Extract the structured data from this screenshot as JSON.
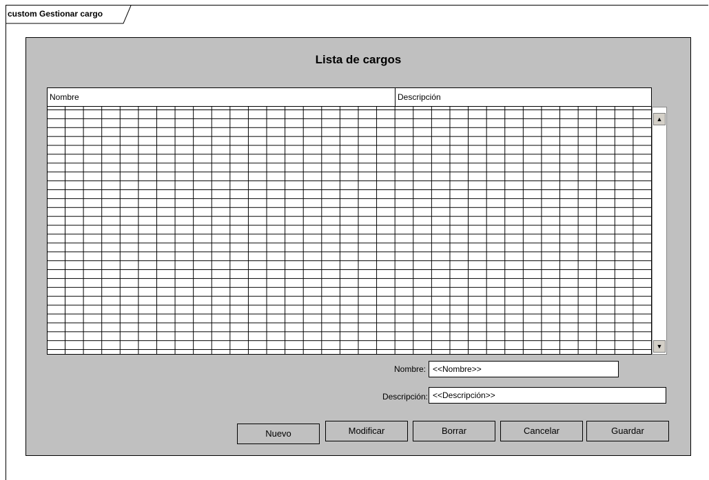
{
  "frame": {
    "title": "custom Gestionar cargo"
  },
  "window": {
    "title": "Lista de cargos",
    "table": {
      "columns": [
        "Nombre",
        "Descripción"
      ]
    },
    "form": {
      "nombre_label": "Nombre:",
      "nombre_value": "<<Nombre>>",
      "descripcion_label": "Descripción:",
      "descripcion_value": "<<Descripción>>"
    },
    "buttons": {
      "nuevo": "Nuevo",
      "modificar": "Modificar",
      "borrar": "Borrar",
      "cancelar": "Cancelar",
      "guardar": "Guardar"
    }
  },
  "icons": {
    "scroll_up": "arrow-up-icon",
    "scroll_down": "arrow-down-icon"
  }
}
